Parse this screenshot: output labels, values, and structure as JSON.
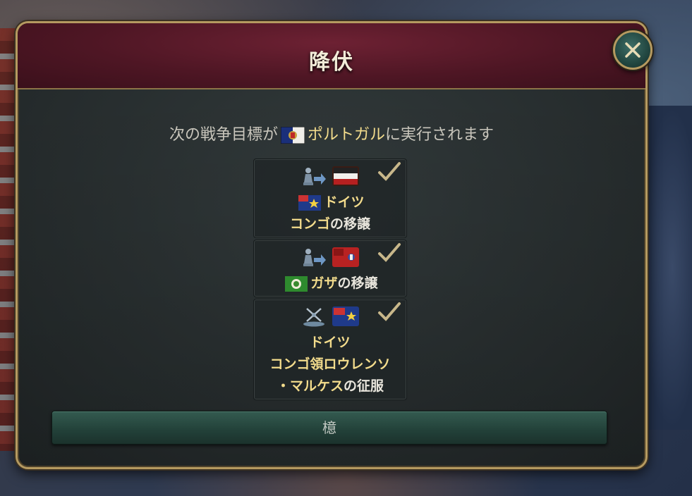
{
  "dialog": {
    "title": "降伏",
    "subtitle_pre": "次の戦争目標が",
    "subtitle_country": "ポルトガル",
    "subtitle_post": "に実行されます",
    "confirm_label": "檍"
  },
  "goals": [
    {
      "action_icon": "pawn-transfer-icon",
      "target_flag": "german-empire-flag",
      "lines": [
        {
          "flag": "german-congo-flag",
          "text": "ドイツ",
          "white_suffix": ""
        },
        {
          "flag": "",
          "text": "コンゴ",
          "white_suffix": "の移譲"
        }
      ],
      "status_icon": "checkmark-icon"
    },
    {
      "action_icon": "pawn-transfer-icon",
      "target_flag": "red-ensign-flag",
      "lines": [
        {
          "flag": "gaza-flag",
          "text": "ガザ",
          "white_suffix": "の移譲"
        }
      ],
      "status_icon": "checkmark-icon"
    },
    {
      "action_icon": "crossed-swords-icon",
      "target_flag": "german-congo-flag",
      "lines": [
        {
          "flag": "",
          "text": "ドイツ",
          "white_suffix": ""
        },
        {
          "flag": "",
          "text": "コンゴ領ロウレンソ",
          "white_suffix": ""
        },
        {
          "flag": "",
          "text": "・マルケス",
          "white_suffix": "の征服"
        }
      ],
      "status_icon": "checkmark-icon"
    }
  ],
  "colors": {
    "header": "#5a1a2b",
    "gold_text": "#f3dc8c",
    "frame": "#b59a60",
    "button": "#2a4a42"
  }
}
